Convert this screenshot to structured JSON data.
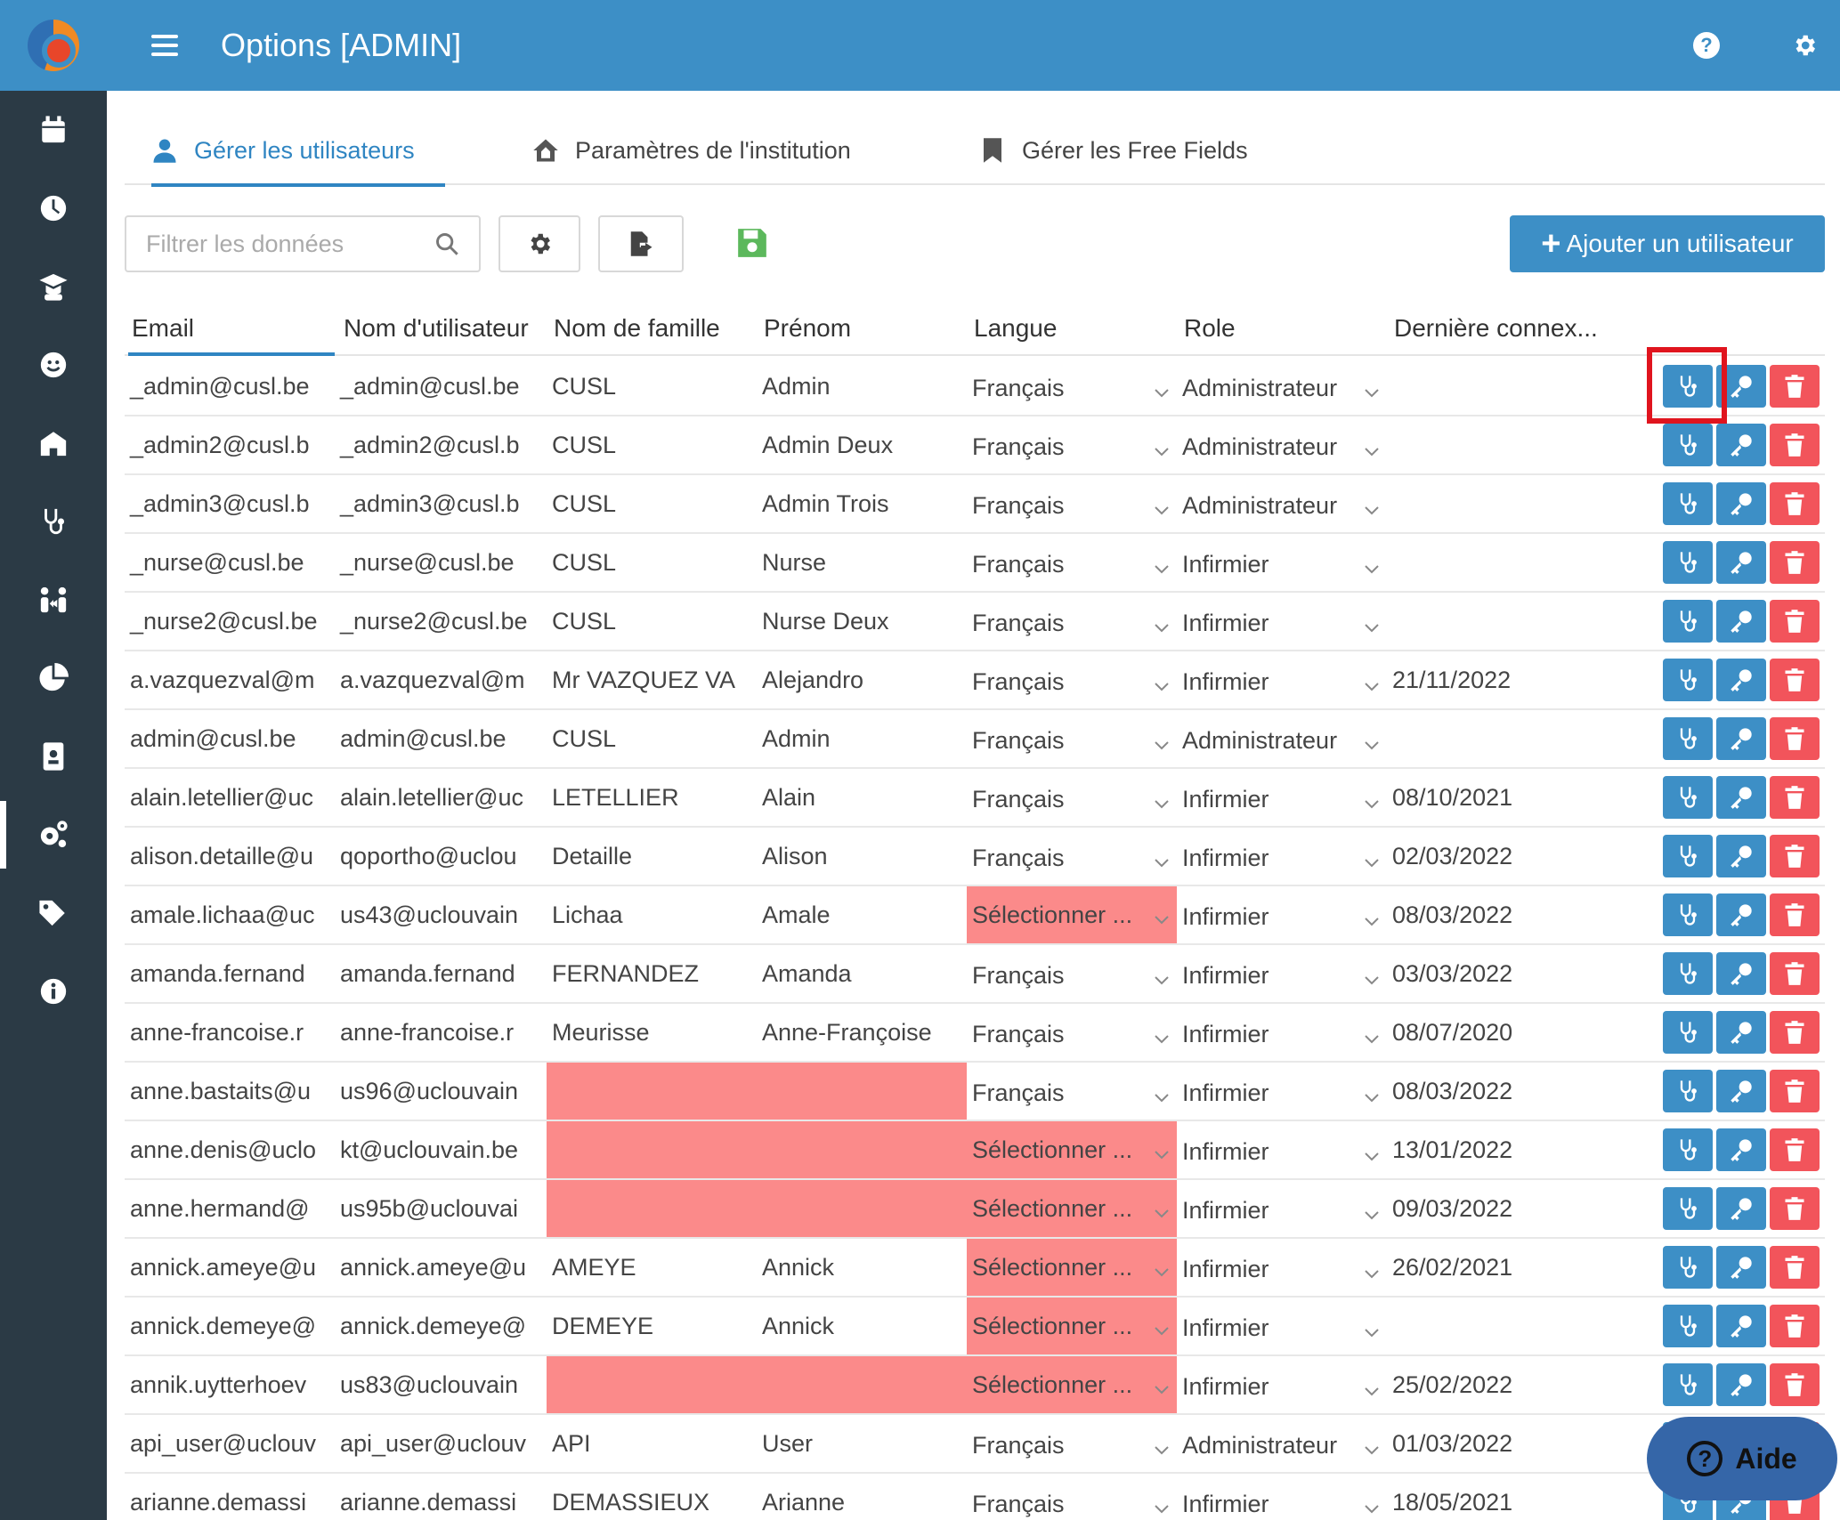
{
  "topbar": {
    "title": "Options [ADMIN]",
    "help_label": "?"
  },
  "sidebar": {
    "items": [
      {
        "icon": "calendar-icon"
      },
      {
        "icon": "clock-icon"
      },
      {
        "icon": "graduate-icon"
      },
      {
        "icon": "smiley-icon"
      },
      {
        "icon": "institution-icon"
      },
      {
        "icon": "stethoscope-icon"
      },
      {
        "icon": "people-arrows-icon"
      },
      {
        "icon": "pie-chart-icon"
      },
      {
        "icon": "id-badge-icon"
      },
      {
        "icon": "cogs-icon",
        "active": true
      },
      {
        "icon": "tags-icon"
      },
      {
        "icon": "info-icon"
      }
    ]
  },
  "tabs": [
    {
      "label": "Gérer les utilisateurs",
      "icon": "user-icon",
      "active": true
    },
    {
      "label": "Paramètres de l'institution",
      "icon": "home-icon"
    },
    {
      "label": "Gérer les Free Fields",
      "icon": "bookmark-icon"
    }
  ],
  "toolbar": {
    "search_placeholder": "Filtrer les données",
    "add_label": "Ajouter un utilisateur"
  },
  "columns": [
    "Email",
    "Nom d'utilisateur",
    "Nom de famille",
    "Prénom",
    "Langue",
    "Role",
    "Dernière connex..."
  ],
  "rows": [
    {
      "email": "_admin@cusl.be",
      "username": "_admin@cusl.be",
      "lastname": "CUSL",
      "firstname": "Admin",
      "lang": "Français",
      "role": "Administrateur",
      "last": ""
    },
    {
      "email": "_admin2@cusl.b",
      "username": "_admin2@cusl.b",
      "lastname": "CUSL",
      "firstname": "Admin Deux",
      "lang": "Français",
      "role": "Administrateur",
      "last": ""
    },
    {
      "email": "_admin3@cusl.b",
      "username": "_admin3@cusl.b",
      "lastname": "CUSL",
      "firstname": "Admin Trois",
      "lang": "Français",
      "role": "Administrateur",
      "last": ""
    },
    {
      "email": "_nurse@cusl.be",
      "username": "_nurse@cusl.be",
      "lastname": "CUSL",
      "firstname": "Nurse",
      "lang": "Français",
      "role": "Infirmier",
      "last": ""
    },
    {
      "email": "_nurse2@cusl.be",
      "username": "_nurse2@cusl.be",
      "lastname": "CUSL",
      "firstname": "Nurse Deux",
      "lang": "Français",
      "role": "Infirmier",
      "last": ""
    },
    {
      "email": "a.vazquezval@m",
      "username": "a.vazquezval@m",
      "lastname": "Mr VAZQUEZ VA",
      "firstname": "Alejandro",
      "lang": "Français",
      "role": "Infirmier",
      "last": "21/11/2022"
    },
    {
      "email": "admin@cusl.be",
      "username": "admin@cusl.be",
      "lastname": "CUSL",
      "firstname": "Admin",
      "lang": "Français",
      "role": "Administrateur",
      "last": ""
    },
    {
      "email": "alain.letellier@uc",
      "username": "alain.letellier@uc",
      "lastname": "LETELLIER",
      "firstname": "Alain",
      "lang": "Français",
      "role": "Infirmier",
      "last": "08/10/2021"
    },
    {
      "email": "alison.detaille@u",
      "username": "qoportho@uclou",
      "lastname": "Detaille",
      "firstname": "Alison",
      "lang": "Français",
      "role": "Infirmier",
      "last": "02/03/2022"
    },
    {
      "email": "amale.lichaa@uc",
      "username": "us43@uclouvain",
      "lastname": "Lichaa",
      "firstname": "Amale",
      "lang": "Sélectionner ...",
      "role": "Infirmier",
      "last": "08/03/2022",
      "lang_err": true
    },
    {
      "email": "amanda.fernand",
      "username": "amanda.fernand",
      "lastname": "FERNANDEZ",
      "firstname": "Amanda",
      "lang": "Français",
      "role": "Infirmier",
      "last": "03/03/2022"
    },
    {
      "email": "anne-francoise.r",
      "username": "anne-francoise.r",
      "lastname": "Meurisse",
      "firstname": "Anne-Françoise",
      "lang": "Français",
      "role": "Infirmier",
      "last": "08/07/2020"
    },
    {
      "email": "anne.bastaits@u",
      "username": "us96@uclouvain",
      "lastname": "",
      "firstname": "",
      "lang": "Français",
      "role": "Infirmier",
      "last": "08/03/2022",
      "name_err": true
    },
    {
      "email": "anne.denis@uclo",
      "username": "kt@uclouvain.be",
      "lastname": "",
      "firstname": "",
      "lang": "Sélectionner ...",
      "role": "Infirmier",
      "last": "13/01/2022",
      "name_err": true,
      "lang_err": true
    },
    {
      "email": "anne.hermand@",
      "username": "us95b@uclouvai",
      "lastname": "",
      "firstname": "",
      "lang": "Sélectionner ...",
      "role": "Infirmier",
      "last": "09/03/2022",
      "name_err": true,
      "lang_err": true
    },
    {
      "email": "annick.ameye@u",
      "username": "annick.ameye@u",
      "lastname": "AMEYE",
      "firstname": "Annick",
      "lang": "Sélectionner ...",
      "role": "Infirmier",
      "last": "26/02/2021",
      "lang_err": true
    },
    {
      "email": "annick.demeye@",
      "username": "annick.demeye@",
      "lastname": "DEMEYE",
      "firstname": "Annick",
      "lang": "Sélectionner ...",
      "role": "Infirmier",
      "last": "",
      "lang_err": true
    },
    {
      "email": "annik.uytterhoev",
      "username": "us83@uclouvain",
      "lastname": "",
      "firstname": "",
      "lang": "Sélectionner ...",
      "role": "Infirmier",
      "last": "25/02/2022",
      "name_err": true,
      "lang_err": true
    },
    {
      "email": "api_user@uclouv",
      "username": "api_user@uclouv",
      "lastname": "API",
      "firstname": "User",
      "lang": "Français",
      "role": "Administrateur",
      "last": "01/03/2022"
    },
    {
      "email": "arianne.demassi",
      "username": "arianne.demassi",
      "lastname": "DEMASSIEUX",
      "firstname": "Arianne",
      "lang": "Français",
      "role": "Infirmier",
      "last": "18/05/2021"
    }
  ],
  "aide": {
    "label": "Aide",
    "q": "?"
  },
  "colors": {
    "primary": "#3d8fc6",
    "sidebar": "#2b3a45",
    "danger": "#f2545b",
    "error_fill": "#fb8a8a",
    "highlight": "#e0141e",
    "save": "#5cb85c"
  }
}
